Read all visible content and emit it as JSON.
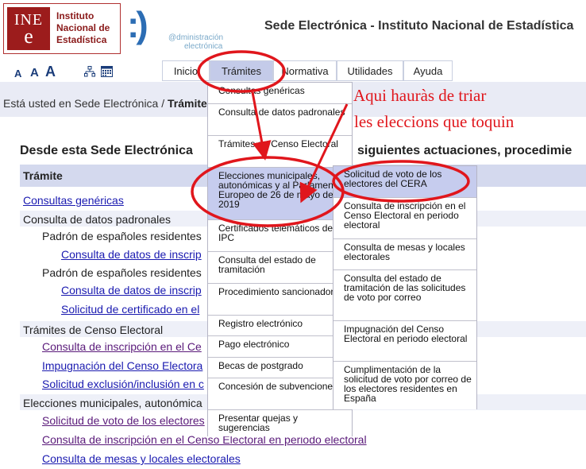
{
  "header": {
    "logo_mark_top": "INE",
    "logo_mark_bottom": "e",
    "logo_line1": "Instituto",
    "logo_line2": "Nacional de",
    "logo_line3": "Estadística",
    "admin_face": ":)",
    "admin_line1": "@dministración",
    "admin_line2": "electrónica",
    "site_title": "Sede Electrónica - Instituto Nacional de Estadística"
  },
  "toolbar": {
    "font_small": "A",
    "font_medium": "A",
    "font_large": "A",
    "icons": [
      "sitemap-icon",
      "calendar-icon"
    ]
  },
  "nav": {
    "tabs": [
      {
        "label": "Inicio"
      },
      {
        "label": "Trámites"
      },
      {
        "label": "Normativa"
      },
      {
        "label": "Utilidades"
      },
      {
        "label": "Ayuda"
      }
    ],
    "active_tab": "Trámites"
  },
  "breadcrumb": {
    "prefix": "Está usted en Sede Electrónica /",
    "current": "Trámites"
  },
  "main": {
    "heading_left": "Desde esta Sede Electrónica",
    "heading_right": "siguientes actuaciones, procedimie",
    "column_header": "Trámite",
    "rows": [
      {
        "text": "Consultas genéricas"
      },
      {
        "text": "Consulta de datos padronales"
      },
      {
        "text": "Padrón de españoles residentes"
      },
      {
        "text": "Consulta de datos de inscrip"
      },
      {
        "text": "Padrón de españoles residentes"
      },
      {
        "text": "Consulta de datos de inscrip"
      },
      {
        "text": "Solicitud de certificado en el"
      },
      {
        "text": "Trámites de Censo Electoral"
      },
      {
        "text": "Consulta de inscripción en el Ce"
      },
      {
        "text": "Impugnación del Censo Electora"
      },
      {
        "text": "Solicitud exclusión/inclusión en c"
      },
      {
        "text": "Elecciones municipales, autonómica"
      },
      {
        "text": "Solicitud de voto de los electores"
      },
      {
        "text": "Consulta de inscripción en el Censo Electoral en periodo electoral"
      },
      {
        "text": "Consulta de mesas y locales electorales"
      }
    ]
  },
  "menu": {
    "items": [
      {
        "label": "Consultas genéricas"
      },
      {
        "label": "Consulta de datos padronales"
      },
      {
        "label": "Trámites de Censo Electoral"
      },
      {
        "label": "Elecciones municipales, autonómicas y al Parlamento Europeo de 26 de mayo de 2019"
      },
      {
        "label": "Certificados telemáticos del IPC"
      },
      {
        "label": "Consulta del estado de tramitación"
      },
      {
        "label": "Procedimiento sancionador"
      },
      {
        "label": "Registro electrónico"
      },
      {
        "label": "Pago electrónico"
      },
      {
        "label": "Becas de postgrado"
      },
      {
        "label": "Concesión de subvenciones"
      },
      {
        "label": "Presentar quejas y sugerencias"
      }
    ]
  },
  "submenu": {
    "items": [
      {
        "label": "Solicitud de voto de los electores del CERA"
      },
      {
        "label": "Consulta de inscripción en el Censo Electoral en periodo electoral"
      },
      {
        "label": "Consulta de mesas y locales electorales"
      },
      {
        "label": "Consulta del estado de tramitación de las solicitudes de voto por correo"
      },
      {
        "label": "Impugnación del Censo Electoral en periodo electoral"
      },
      {
        "label": "Cumplimentación de la solicitud de voto por correo de los electores residentes en España"
      }
    ]
  },
  "annotation": {
    "line1": "Aqui hauràs de triar",
    "line2": "les eleccions que toquin",
    "color": "#e0161c"
  },
  "colors": {
    "brand": "#9c1c1c",
    "active_tab": "#c4cbe9",
    "menu_highlight": "#c6ccee",
    "link": "#1a1ab0"
  }
}
